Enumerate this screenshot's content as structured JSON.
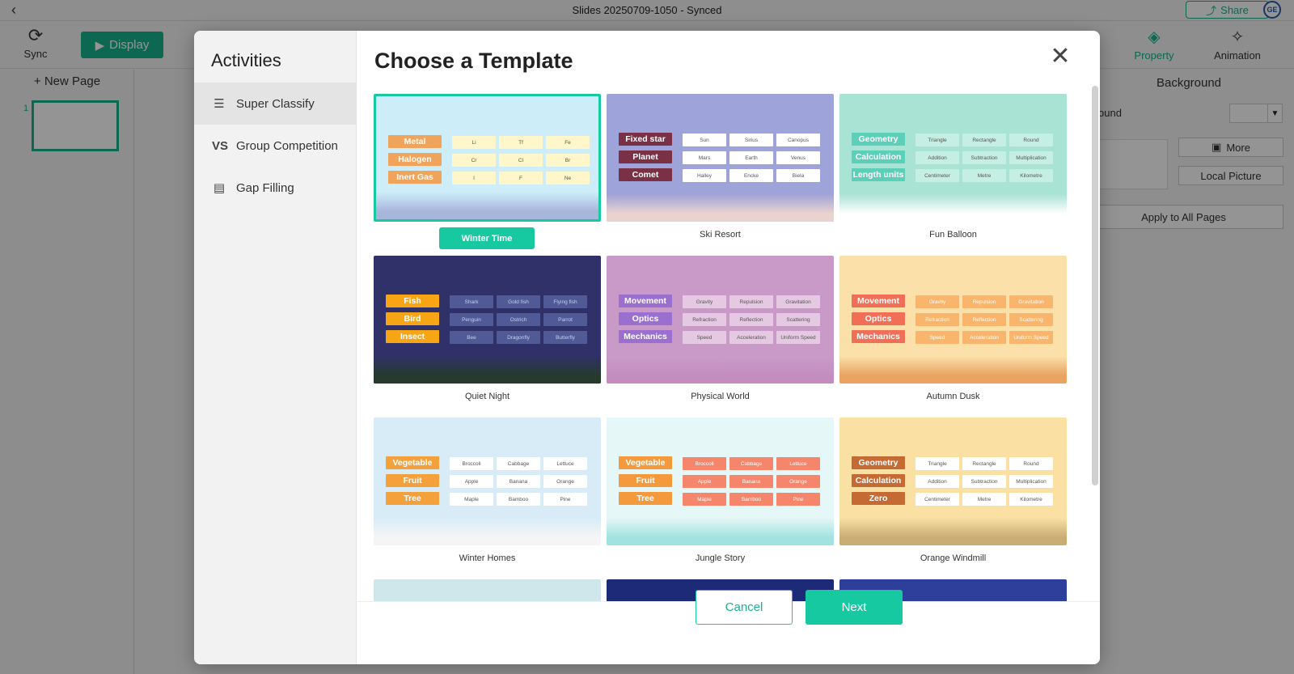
{
  "app": {
    "window_title": "Slides 20250709-1050 - Synced",
    "share_label": "Share",
    "avatar_text": "GE",
    "sync_label": "Sync",
    "display_label": "Display",
    "property_label": "Property",
    "animation_label": "Animation",
    "new_page_label": "+ New Page",
    "slide_number": "1",
    "right_panel": {
      "title": "Background",
      "background_label": "kground",
      "more_label": "More",
      "local_picture_label": "Local Picture",
      "apply_all_label": "Apply to All Pages"
    },
    "accent_color": "#17b38d"
  },
  "modal": {
    "sidebar_title": "Activities",
    "activities": [
      {
        "label": "Super Classify",
        "icon": "list-icon",
        "glyph": "☰",
        "selected": true
      },
      {
        "label": "Group Competition",
        "icon": "vs-icon",
        "glyph": "VS",
        "selected": false
      },
      {
        "label": "Gap Filling",
        "icon": "gap-fill-icon",
        "glyph": "▤",
        "selected": false
      }
    ],
    "title": "Choose a Template",
    "cancel_label": "Cancel",
    "next_label": "Next",
    "selected_color": "#17c9a0"
  },
  "templates": [
    {
      "name": "Winter Time",
      "selected": true,
      "bg": "#cdeef9",
      "scene": "#a9b6dc",
      "cat_color": "#f0a35a",
      "cell_color": "#fff6c9",
      "cats": [
        "Metal",
        "Halogen",
        "Inert Gas"
      ],
      "cells": [
        "Li",
        "Tf",
        "Fe",
        "Cr",
        "Cl",
        "Br",
        "I",
        "F",
        "Ne"
      ]
    },
    {
      "name": "Ski Resort",
      "selected": false,
      "bg": "#9ea3d9",
      "scene": "#ead2cf",
      "cat_color": "#7a3146",
      "cell_color": "#ffffff",
      "cats": [
        "Fixed star",
        "Planet",
        "Comet"
      ],
      "cells": [
        "Sun",
        "Sirius",
        "Canopus",
        "Mars",
        "Earth",
        "Venus",
        "Halley",
        "Encke",
        "Biela"
      ]
    },
    {
      "name": "Fun Balloon",
      "selected": false,
      "bg": "#a9e3d3",
      "scene": "#ffffff",
      "cat_color": "#5ccfb9",
      "cell_color": "#c6efe4",
      "cats": [
        "Geometry",
        "Calculation",
        "Length units"
      ],
      "cells": [
        "Triangle",
        "Rectangle",
        "Round",
        "Addition",
        "Subtraction",
        "Multiplication",
        "Centimeter",
        "Metre",
        "Kilometre"
      ]
    },
    {
      "name": "Quiet Night",
      "selected": false,
      "bg": "#2f3168",
      "scene": "#263a2e",
      "cat_color": "#f7a515",
      "cell_color": "#4f5a96",
      "cats": [
        "Fish",
        "Bird",
        "Insect"
      ],
      "cells": [
        "Shark",
        "Gold fish",
        "Flying fish",
        "Penguin",
        "Ostrich",
        "Parrot",
        "Bee",
        "Dragonfly",
        "Butterfly"
      ]
    },
    {
      "name": "Physical World",
      "selected": false,
      "bg": "#c99ac8",
      "scene": "#c38ebf",
      "cat_color": "#9b6fd0",
      "cell_color": "#e5c9e3",
      "cats": [
        "Movement",
        "Optics",
        "Mechanics"
      ],
      "cells": [
        "Gravity",
        "Repulsion",
        "Gravitation",
        "Refraction",
        "Reflection",
        "Scattering",
        "Speed",
        "Acceleration",
        "Uniform Speed"
      ]
    },
    {
      "name": "Autumn Dusk",
      "selected": false,
      "bg": "#fbe0a9",
      "scene": "#e9a462",
      "cat_color": "#f26f57",
      "cell_color": "#f9b56b",
      "cats": [
        "Movement",
        "Optics",
        "Mechanics"
      ],
      "cells": [
        "Gravity",
        "Repulsion",
        "Gravitation",
        "Refraction",
        "Reflection",
        "Scattering",
        "Speed",
        "Acceleration",
        "Uniform Speed"
      ]
    },
    {
      "name": "Winter Homes",
      "selected": false,
      "bg": "#d8ecf7",
      "scene": "#f5f5f5",
      "cat_color": "#f4a03b",
      "cell_color": "#ffffff",
      "cats": [
        "Vegetable",
        "Fruit",
        "Tree"
      ],
      "cells": [
        "Broccoli",
        "Cabbage",
        "Lettuce",
        "Apple",
        "Banana",
        "Orange",
        "Maple",
        "Bamboo",
        "Pine"
      ]
    },
    {
      "name": "Jungle Story",
      "selected": false,
      "bg": "#e5f7f7",
      "scene": "#a2e3df",
      "cat_color": "#f59a3c",
      "cell_color": "#f5866b",
      "cats": [
        "Vegetable",
        "Fruit",
        "Tree"
      ],
      "cells": [
        "Broccoli",
        "Cabbage",
        "Lettuce",
        "Apple",
        "Banana",
        "Orange",
        "Maple",
        "Bamboo",
        "Pine"
      ]
    },
    {
      "name": "Orange Windmill",
      "selected": false,
      "bg": "#fae0a2",
      "scene": "#c9ad75",
      "cat_color": "#c46a32",
      "cell_color": "#ffffff",
      "cats": [
        "Geometry",
        "Calculation",
        "Zero"
      ],
      "cells": [
        "Triangle",
        "Rectangle",
        "Round",
        "Addition",
        "Subtraction",
        "Multiplication",
        "Centimeter",
        "Metre",
        "Kilometre"
      ]
    },
    {
      "name": "",
      "selected": false,
      "bg": "#cfe6ea",
      "scene": "#cfe6ea",
      "cat_color": "#cfe6ea",
      "cell_color": "#cfe6ea",
      "cats": [],
      "cells": []
    },
    {
      "name": "",
      "selected": false,
      "bg": "#1c2a78",
      "scene": "#1c2a78",
      "cat_color": "#1c2a78",
      "cell_color": "#1c2a78",
      "cats": [],
      "cells": []
    },
    {
      "name": "",
      "selected": false,
      "bg": "#2d3f9b",
      "scene": "#2d3f9b",
      "cat_color": "#2d3f9b",
      "cell_color": "#2d3f9b",
      "cats": [],
      "cells": []
    }
  ]
}
